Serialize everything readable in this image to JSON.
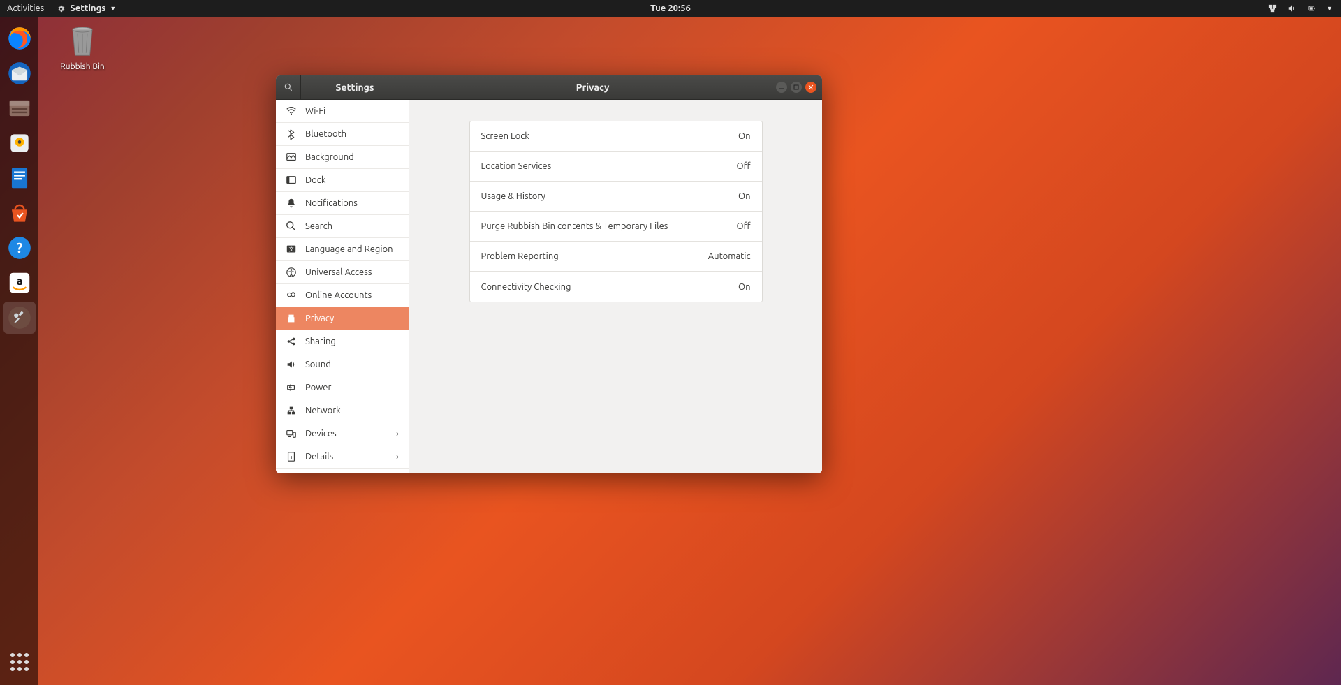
{
  "topbar": {
    "activities": "Activities",
    "app_name": "Settings",
    "clock": "Tue 20:56"
  },
  "desktop": {
    "rubbish_bin": "Rubbish Bin"
  },
  "window": {
    "header_left": "Settings",
    "header_right": "Privacy"
  },
  "sidebar": [
    {
      "icon": "wifi",
      "label": "Wi-Fi"
    },
    {
      "icon": "bluetooth",
      "label": "Bluetooth"
    },
    {
      "icon": "background",
      "label": "Background"
    },
    {
      "icon": "dock",
      "label": "Dock"
    },
    {
      "icon": "notifications",
      "label": "Notifications"
    },
    {
      "icon": "search",
      "label": "Search"
    },
    {
      "icon": "language",
      "label": "Language and Region"
    },
    {
      "icon": "accessibility",
      "label": "Universal Access"
    },
    {
      "icon": "accounts",
      "label": "Online Accounts"
    },
    {
      "icon": "privacy",
      "label": "Privacy"
    },
    {
      "icon": "sharing",
      "label": "Sharing"
    },
    {
      "icon": "sound",
      "label": "Sound"
    },
    {
      "icon": "power",
      "label": "Power"
    },
    {
      "icon": "network",
      "label": "Network"
    },
    {
      "icon": "devices",
      "label": "Devices",
      "chevron": true
    },
    {
      "icon": "details",
      "label": "Details",
      "chevron": true
    }
  ],
  "privacy_rows": [
    {
      "label": "Screen Lock",
      "value": "On"
    },
    {
      "label": "Location Services",
      "value": "Off"
    },
    {
      "label": "Usage & History",
      "value": "On"
    },
    {
      "label": "Purge Rubbish Bin contents & Temporary Files",
      "value": "Off"
    },
    {
      "label": "Problem Reporting",
      "value": "Automatic"
    },
    {
      "label": "Connectivity Checking",
      "value": "On"
    }
  ]
}
